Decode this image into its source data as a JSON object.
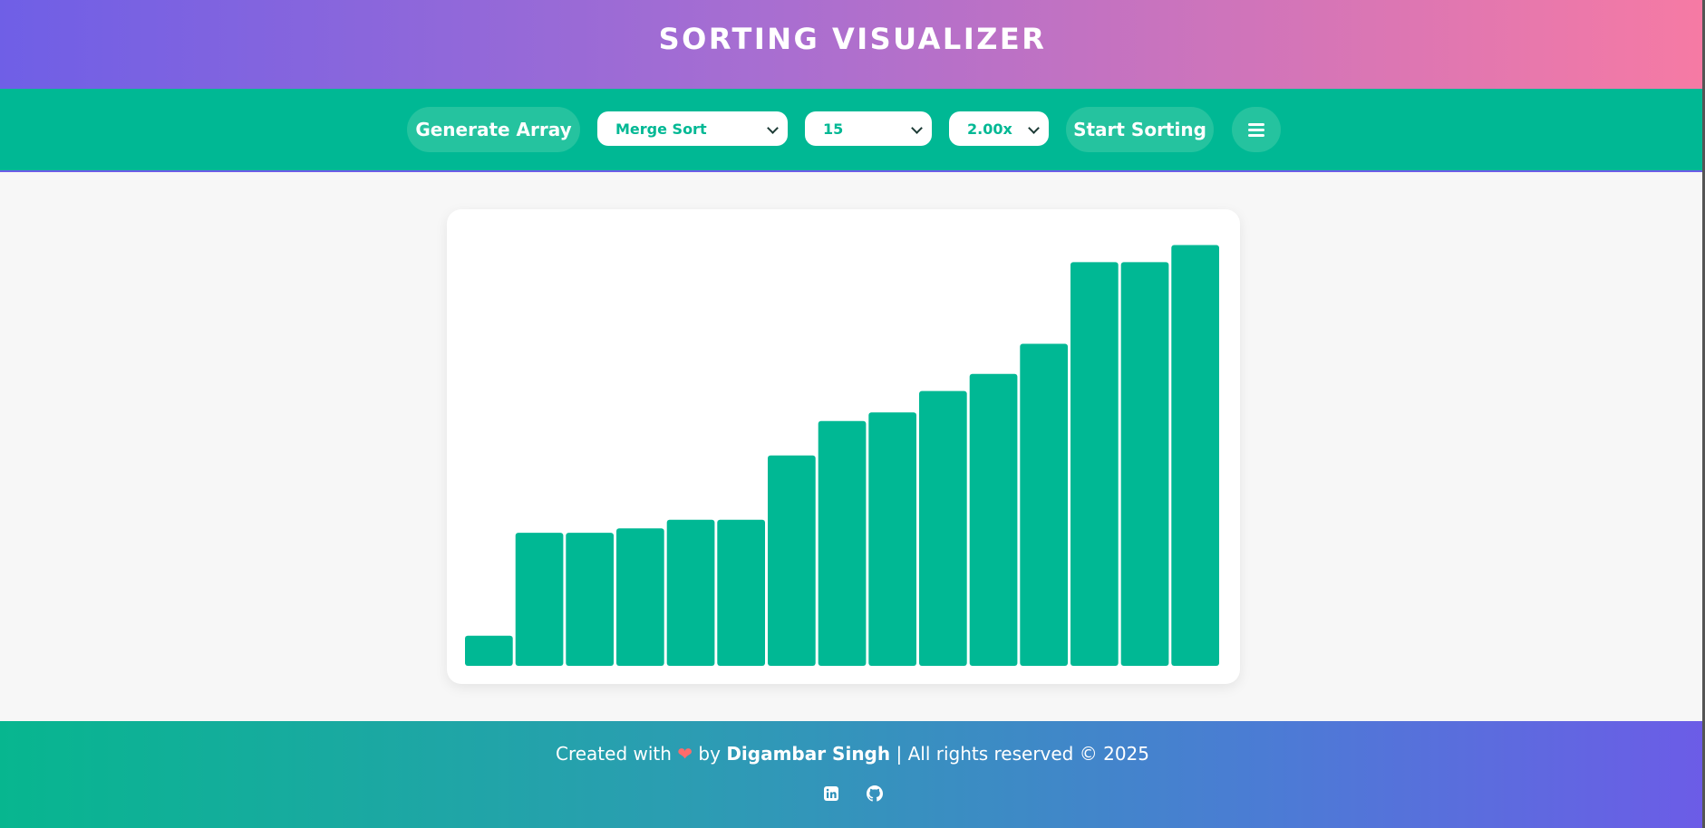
{
  "header": {
    "title": "SORTING VISUALIZER"
  },
  "toolbar": {
    "generate_label": "Generate Array",
    "algorithm": "Merge Sort",
    "size": "15",
    "speed": "2.00x",
    "start_label": "Start Sorting",
    "menu_icon": "hamburger-menu-icon"
  },
  "chart_data": {
    "type": "bar",
    "values": [
      7,
      31,
      31,
      32,
      34,
      34,
      49,
      57,
      59,
      64,
      68,
      75,
      94,
      94,
      98
    ],
    "ylim": [
      0,
      100
    ],
    "color": "#00b894"
  },
  "footer": {
    "prefix": "Created with",
    "by": "by",
    "author": "Digambar Singh",
    "suffix": "| All rights reserved © 2025",
    "icons": [
      "linkedin-icon",
      "github-icon"
    ]
  },
  "colors": {
    "accent": "#00b894",
    "purple": "#6c5ce7",
    "pink": "#fd79a8"
  }
}
